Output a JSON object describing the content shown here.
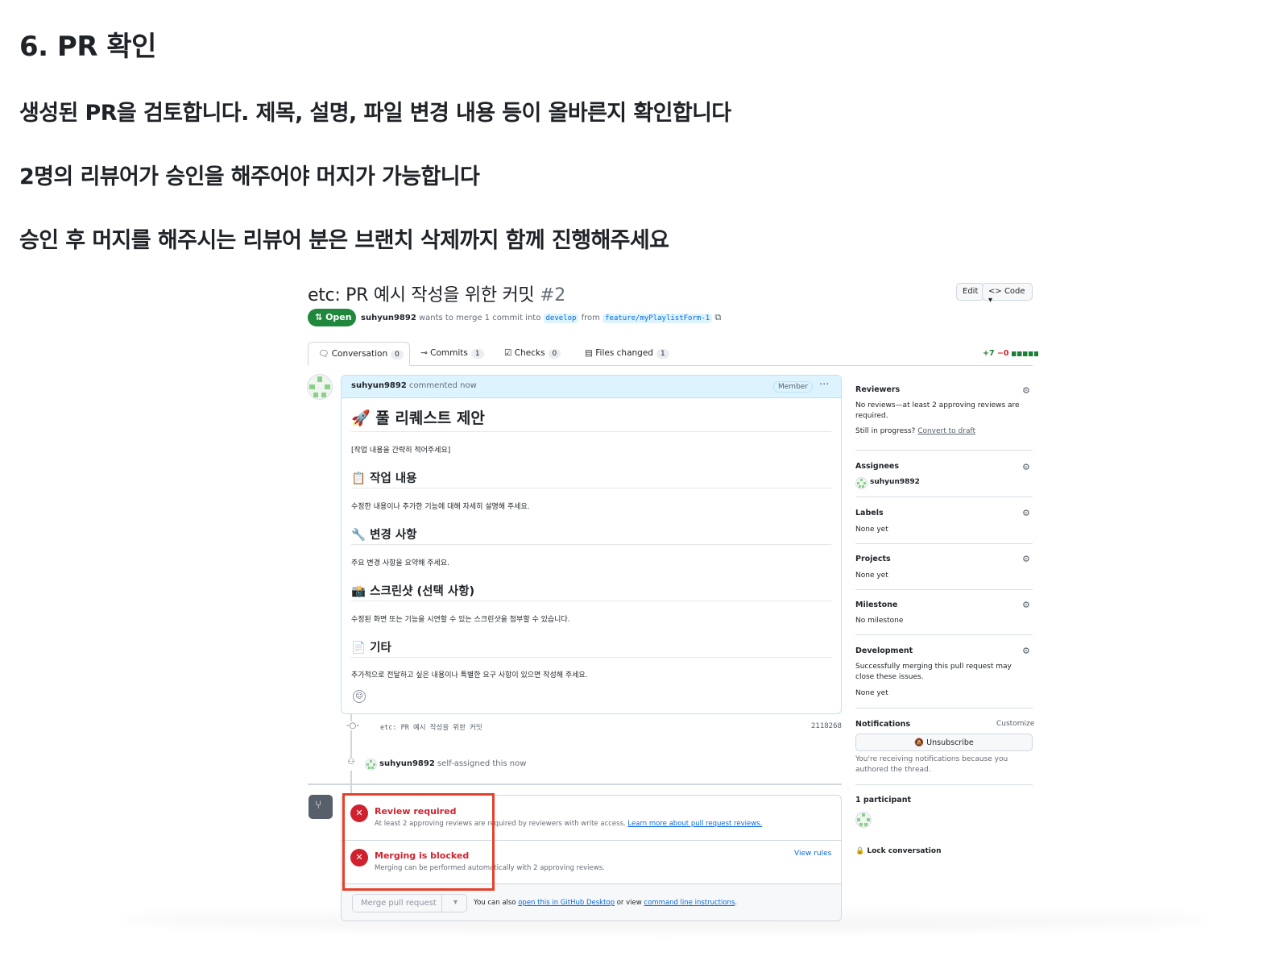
{
  "doc": {
    "heading": "6. PR 확인",
    "para1": "생성된 PR을 검토합니다. 제목, 설명, 파일 변경 내용 등이 올바른지 확인합니다",
    "para2": "2명의 리뷰어가 승인을 해주어야 머지가 가능합니다",
    "para3": "승인 후 머지를 해주시는 리뷰어 분은 브랜치 삭제까지 함께 진행해주세요"
  },
  "pr": {
    "title": "etc: PR 예시 작성을 위한 커밋",
    "number": "#2",
    "edit_label": "Edit",
    "code_label": "Code",
    "state": "Open",
    "author": "suhyun9892",
    "meta_mid": "wants to merge 1 commit into",
    "base_branch": "develop",
    "meta_from": "from",
    "head_branch": "feature/myPlaylistForm-1",
    "diff_add": "+7",
    "diff_del": "−0"
  },
  "tabs": [
    {
      "label": "Conversation",
      "count": "0"
    },
    {
      "label": "Commits",
      "count": "1"
    },
    {
      "label": "Checks",
      "count": "0"
    },
    {
      "label": "Files changed",
      "count": "1"
    }
  ],
  "comment": {
    "author": "suhyun9892",
    "action": "commented now",
    "role": "Member",
    "h1": "🚀 풀 리퀘스트 제안",
    "intro": "[작업 내용을 간략히 적어주세요]",
    "sections": [
      {
        "title": "📋 작업 내용",
        "text": "수정한 내용이나 추가한 기능에 대해 자세히 설명해 주세요."
      },
      {
        "title": "🔧 변경 사항",
        "text": "주요 변경 사항을 요약해 주세요."
      },
      {
        "title": "📸 스크린샷 (선택 사항)",
        "text": "수정된 화면 또는 기능을 시연할 수 있는 스크린샷을 첨부할 수 있습니다."
      },
      {
        "title": "📄 기타",
        "text": "추가적으로 전달하고 싶은 내용이나 특별한 요구 사항이 있으면 작성해 주세요."
      }
    ]
  },
  "timeline": {
    "commit_msg": "etc: PR 예시 작성을 위한 커밋",
    "commit_sha": "2118268",
    "assign_user": "suhyun9892",
    "assign_text": "self-assigned this now"
  },
  "merge": {
    "review_title": "Review required",
    "review_sub": "At least 2 approving reviews are required by reviewers with write access.",
    "review_link": "Learn more about pull request reviews.",
    "blocked_title": "Merging is blocked",
    "blocked_sub": "Merging can be performed automatically with 2 approving reviews.",
    "view_rules": "View rules",
    "merge_button": "Merge pull request",
    "also_prefix": "You can also",
    "desktop_link": "open this in GitHub Desktop",
    "or_view": "or view",
    "cli_link": "command line instructions",
    "period": "."
  },
  "sidebar": {
    "reviewers_title": "Reviewers",
    "reviewers_text": "No reviews—at least 2 approving reviews are required.",
    "still_progress": "Still in progress?",
    "convert_draft": "Convert to draft",
    "assignees_title": "Assignees",
    "assignee_name": "suhyun9892",
    "labels_title": "Labels",
    "labels_value": "None yet",
    "projects_title": "Projects",
    "projects_value": "None yet",
    "milestone_title": "Milestone",
    "milestone_value": "No milestone",
    "development_title": "Development",
    "development_text": "Successfully merging this pull request may close these issues.",
    "development_value": "None yet",
    "notifications_title": "Notifications",
    "customize": "Customize",
    "unsubscribe": "Unsubscribe",
    "notify_text": "You're receiving notifications because you authored the thread.",
    "participants": "1 participant",
    "lock": "Lock conversation"
  },
  "colors": {
    "open_green": "#1f883d",
    "danger": "#cf222e",
    "link": "#0969da",
    "highlight_box": "#e5402a"
  }
}
